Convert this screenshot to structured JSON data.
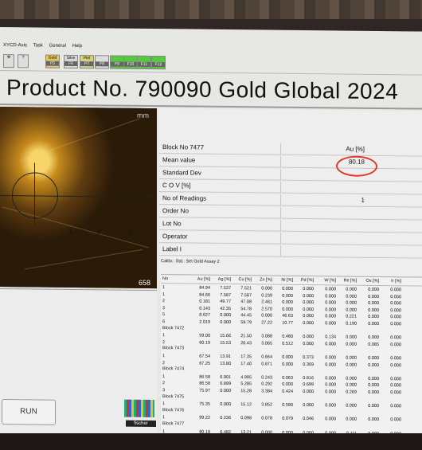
{
  "menu": {
    "items": [
      "XYCD-Axis",
      "Task",
      "General",
      "Help"
    ]
  },
  "toolbar": {
    "buttons": [
      {
        "label": "Gold",
        "key": "F5"
      },
      {
        "label": "Silve",
        "key": "F6"
      },
      {
        "label": "Ptel",
        "key": "F7"
      },
      {
        "label": "",
        "key": "F8"
      },
      {
        "label": "",
        "key": "F9"
      },
      {
        "label": "",
        "key": "F10"
      },
      {
        "label": "",
        "key": "F11"
      },
      {
        "label": "",
        "key": "F12"
      }
    ]
  },
  "title": "Product No. 790090  Gold Global 2024",
  "camera": {
    "scale_numbers": [
      "1",
      "2",
      "3"
    ],
    "corner_value": "658",
    "unit_text": "mm"
  },
  "info": {
    "block": "Block No 7477",
    "column_header": "Au [%]",
    "mean_label": "Mean value",
    "mean_value": "80.18",
    "std_label": "Standard Dev",
    "cov_label": "C O V [%]",
    "readings_label": "No of Readings",
    "readings_value": "1",
    "order_label": "Order No",
    "lot_label": "Lot No",
    "operator_label": "Operator",
    "label_label": "Label I"
  },
  "calibration": "Calibr.: Std.: Set Gold Assay 2",
  "grid": {
    "headers": [
      "No",
      "Au [%]",
      "Ag [%]",
      "Cu [%]",
      "Zn [%]",
      "Ni [%]",
      "Pd [%]",
      "W [%]",
      "Re [%]",
      "Os [%]",
      "Ir [%]"
    ],
    "rows": [
      {
        "no": "1",
        "v": [
          "84.94",
          "7.537",
          "7.521",
          "0.000",
          "0.000",
          "0.000",
          "0.000",
          "0.000",
          "0.000",
          "0.000"
        ]
      },
      {
        "no": "1",
        "v": [
          "84.66",
          "7.587",
          "7.587",
          "0.239",
          "0.000",
          "0.000",
          "0.000",
          "0.000",
          "0.000",
          "0.000"
        ]
      },
      {
        "no": "2",
        "v": [
          "0.181",
          "49.77",
          "47.08",
          "2.461",
          "0.000",
          "0.000",
          "0.000",
          "0.000",
          "0.000",
          "0.000"
        ]
      },
      {
        "no": "3",
        "v": [
          "0.143",
          "42.35",
          "54.78",
          "2.570",
          "0.000",
          "0.000",
          "0.000",
          "0.000",
          "0.000",
          "0.000"
        ]
      },
      {
        "no": "5",
        "v": [
          "8.627",
          "0.000",
          "44.45",
          "0.000",
          "46.63",
          "0.000",
          "0.000",
          "0.221",
          "0.000",
          "0.000"
        ]
      },
      {
        "no": "6",
        "v": [
          "2.019",
          "0.000",
          "59.79",
          "27.22",
          "10.77",
          "0.000",
          "0.000",
          "0.190",
          "0.000",
          "0.000"
        ]
      },
      {
        "block": "Block 7472"
      },
      {
        "no": "1",
        "v": [
          "59.00",
          "15.66",
          "21.50",
          "3.088",
          "0.480",
          "0.000",
          "0.134",
          "0.000",
          "0.000",
          "0.000"
        ]
      },
      {
        "no": "2",
        "v": [
          "60.19",
          "15.53",
          "20.43",
          "3.065",
          "0.512",
          "0.000",
          "0.000",
          "0.000",
          "0.085",
          "0.000"
        ]
      },
      {
        "block": "Block 7473"
      },
      {
        "no": "1",
        "v": [
          "67.54",
          "13.91",
          "17.35",
          "0.664",
          "0.000",
          "0.373",
          "0.000",
          "0.000",
          "0.000",
          "0.000"
        ]
      },
      {
        "no": "2",
        "v": [
          "67.25",
          "13.80",
          "17.40",
          "0.871",
          "0.000",
          "0.369",
          "0.000",
          "0.000",
          "0.000",
          "0.000"
        ]
      },
      {
        "block": "Block 7474"
      },
      {
        "no": "1",
        "v": [
          "86.58",
          "6.901",
          "4.995",
          "0.243",
          "0.063",
          "0.816",
          "0.000",
          "0.000",
          "0.000",
          "0.000"
        ]
      },
      {
        "no": "2",
        "v": [
          "86.58",
          "6.899",
          "5.285",
          "0.292",
          "0.000",
          "0.699",
          "0.000",
          "0.000",
          "0.000",
          "0.000"
        ]
      },
      {
        "no": "3",
        "v": [
          "75.97",
          "0.000",
          "15.28",
          "3.384",
          "0.424",
          "0.000",
          "0.000",
          "0.269",
          "0.000",
          "0.000"
        ]
      },
      {
        "block": "Block 7475"
      },
      {
        "no": "1",
        "v": [
          "75.35",
          "0.000",
          "15.12",
          "3.852",
          "0.580",
          "0.000",
          "0.000",
          "0.000",
          "0.000",
          "0.000"
        ]
      },
      {
        "block": "Block 7476"
      },
      {
        "no": "1",
        "v": [
          "99.22",
          "0.236",
          "0.098",
          "0.078",
          "0.079",
          "0.046",
          "0.000",
          "0.000",
          "0.000",
          "0.000"
        ]
      },
      {
        "block": "Block 7477"
      },
      {
        "no": "1",
        "v": [
          "80.18",
          "6.482",
          "13.21",
          "0.000",
          "0.000",
          "0.000",
          "0.000",
          "0.111",
          "0.000",
          "0.000"
        ]
      }
    ]
  },
  "run_label": "RUN",
  "brand": "fischer",
  "colors": {
    "highlight_circle": "#e2382a",
    "gold_button": "#e2c85a",
    "green_button": "#58c83e"
  }
}
